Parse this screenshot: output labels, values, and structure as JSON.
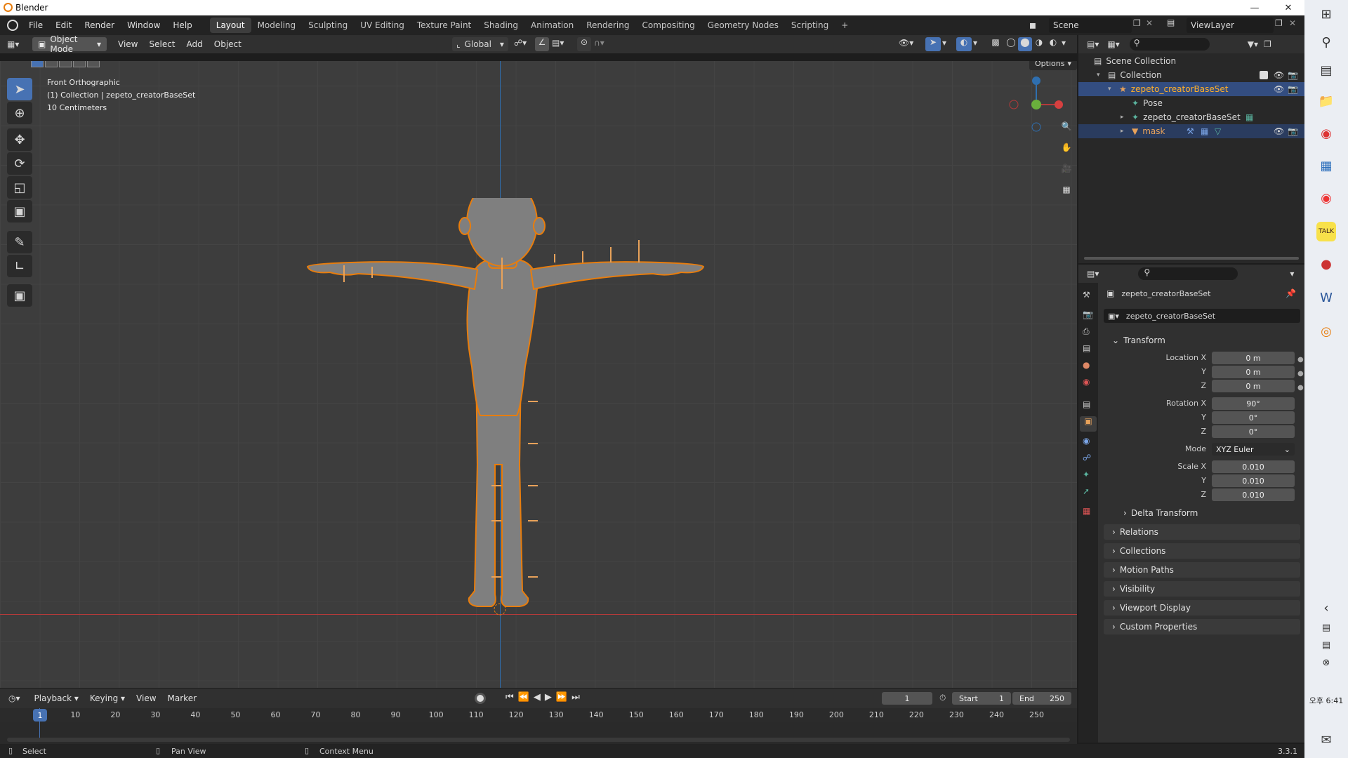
{
  "window": {
    "title": "Blender"
  },
  "menu": {
    "items": [
      "File",
      "Edit",
      "Render",
      "Window",
      "Help"
    ]
  },
  "workspaces": [
    "Layout",
    "Modeling",
    "Sculpting",
    "UV Editing",
    "Texture Paint",
    "Shading",
    "Animation",
    "Rendering",
    "Compositing",
    "Geometry Nodes",
    "Scripting"
  ],
  "active_workspace": "Layout",
  "scene": {
    "name": "Scene",
    "view_layer": "ViewLayer"
  },
  "viewport": {
    "mode": "Object Mode",
    "menus": [
      "View",
      "Select",
      "Add",
      "Object"
    ],
    "orientation": "Global",
    "options_label": "Options",
    "overlay": {
      "view": "Front Orthographic",
      "collection": "(1) Collection | zepeto_creatorBaseSet",
      "scale": "10 Centimeters"
    },
    "gizmo": {
      "z": "Z",
      "y": "Y",
      "x": "X"
    }
  },
  "outliner": {
    "rows": [
      {
        "label": "Scene Collection",
        "icon": "scene-collection-icon"
      },
      {
        "label": "Collection",
        "icon": "collection-icon"
      },
      {
        "label": "zepeto_creatorBaseSet",
        "icon": "armature-icon"
      },
      {
        "label": "Pose",
        "icon": "pose-icon"
      },
      {
        "label": "zepeto_creatorBaseSet",
        "icon": "armature-data-icon"
      },
      {
        "label": "mask",
        "icon": "mesh-icon"
      }
    ]
  },
  "properties": {
    "object_name": "zepeto_creatorBaseSet",
    "datablock": "zepeto_creatorBaseSet",
    "transform": {
      "title": "Transform",
      "location_label": "Location X",
      "rotation_label": "Rotation X",
      "scale_label": "Scale X",
      "y": "Y",
      "z": "Z",
      "location": [
        "0 m",
        "0 m",
        "0 m"
      ],
      "rotation": [
        "90°",
        "0°",
        "0°"
      ],
      "mode_label": "Mode",
      "mode": "XYZ Euler",
      "scale": [
        "0.010",
        "0.010",
        "0.010"
      ],
      "delta": "Delta Transform"
    },
    "panels": [
      "Relations",
      "Collections",
      "Motion Paths",
      "Visibility",
      "Viewport Display",
      "Custom Properties"
    ]
  },
  "timeline": {
    "menus": [
      "Playback",
      "Keying",
      "View",
      "Marker"
    ],
    "current_frame": "1",
    "start_label": "Start",
    "start": "1",
    "end_label": "End",
    "end": "250",
    "ticks": [
      "1",
      "10",
      "20",
      "30",
      "40",
      "50",
      "60",
      "70",
      "80",
      "90",
      "100",
      "110",
      "120",
      "130",
      "140",
      "150",
      "160",
      "170",
      "180",
      "190",
      "200",
      "210",
      "220",
      "230",
      "240",
      "250"
    ]
  },
  "status": {
    "select": "Select",
    "pan": "Pan View",
    "context": "Context Menu",
    "version": "3.3.1"
  },
  "taskbar": {
    "time": "오후 6:41"
  },
  "colors": {
    "accent": "#4772b3",
    "selection_outline": "#e87d0d",
    "active_frame": "#4772b3"
  }
}
